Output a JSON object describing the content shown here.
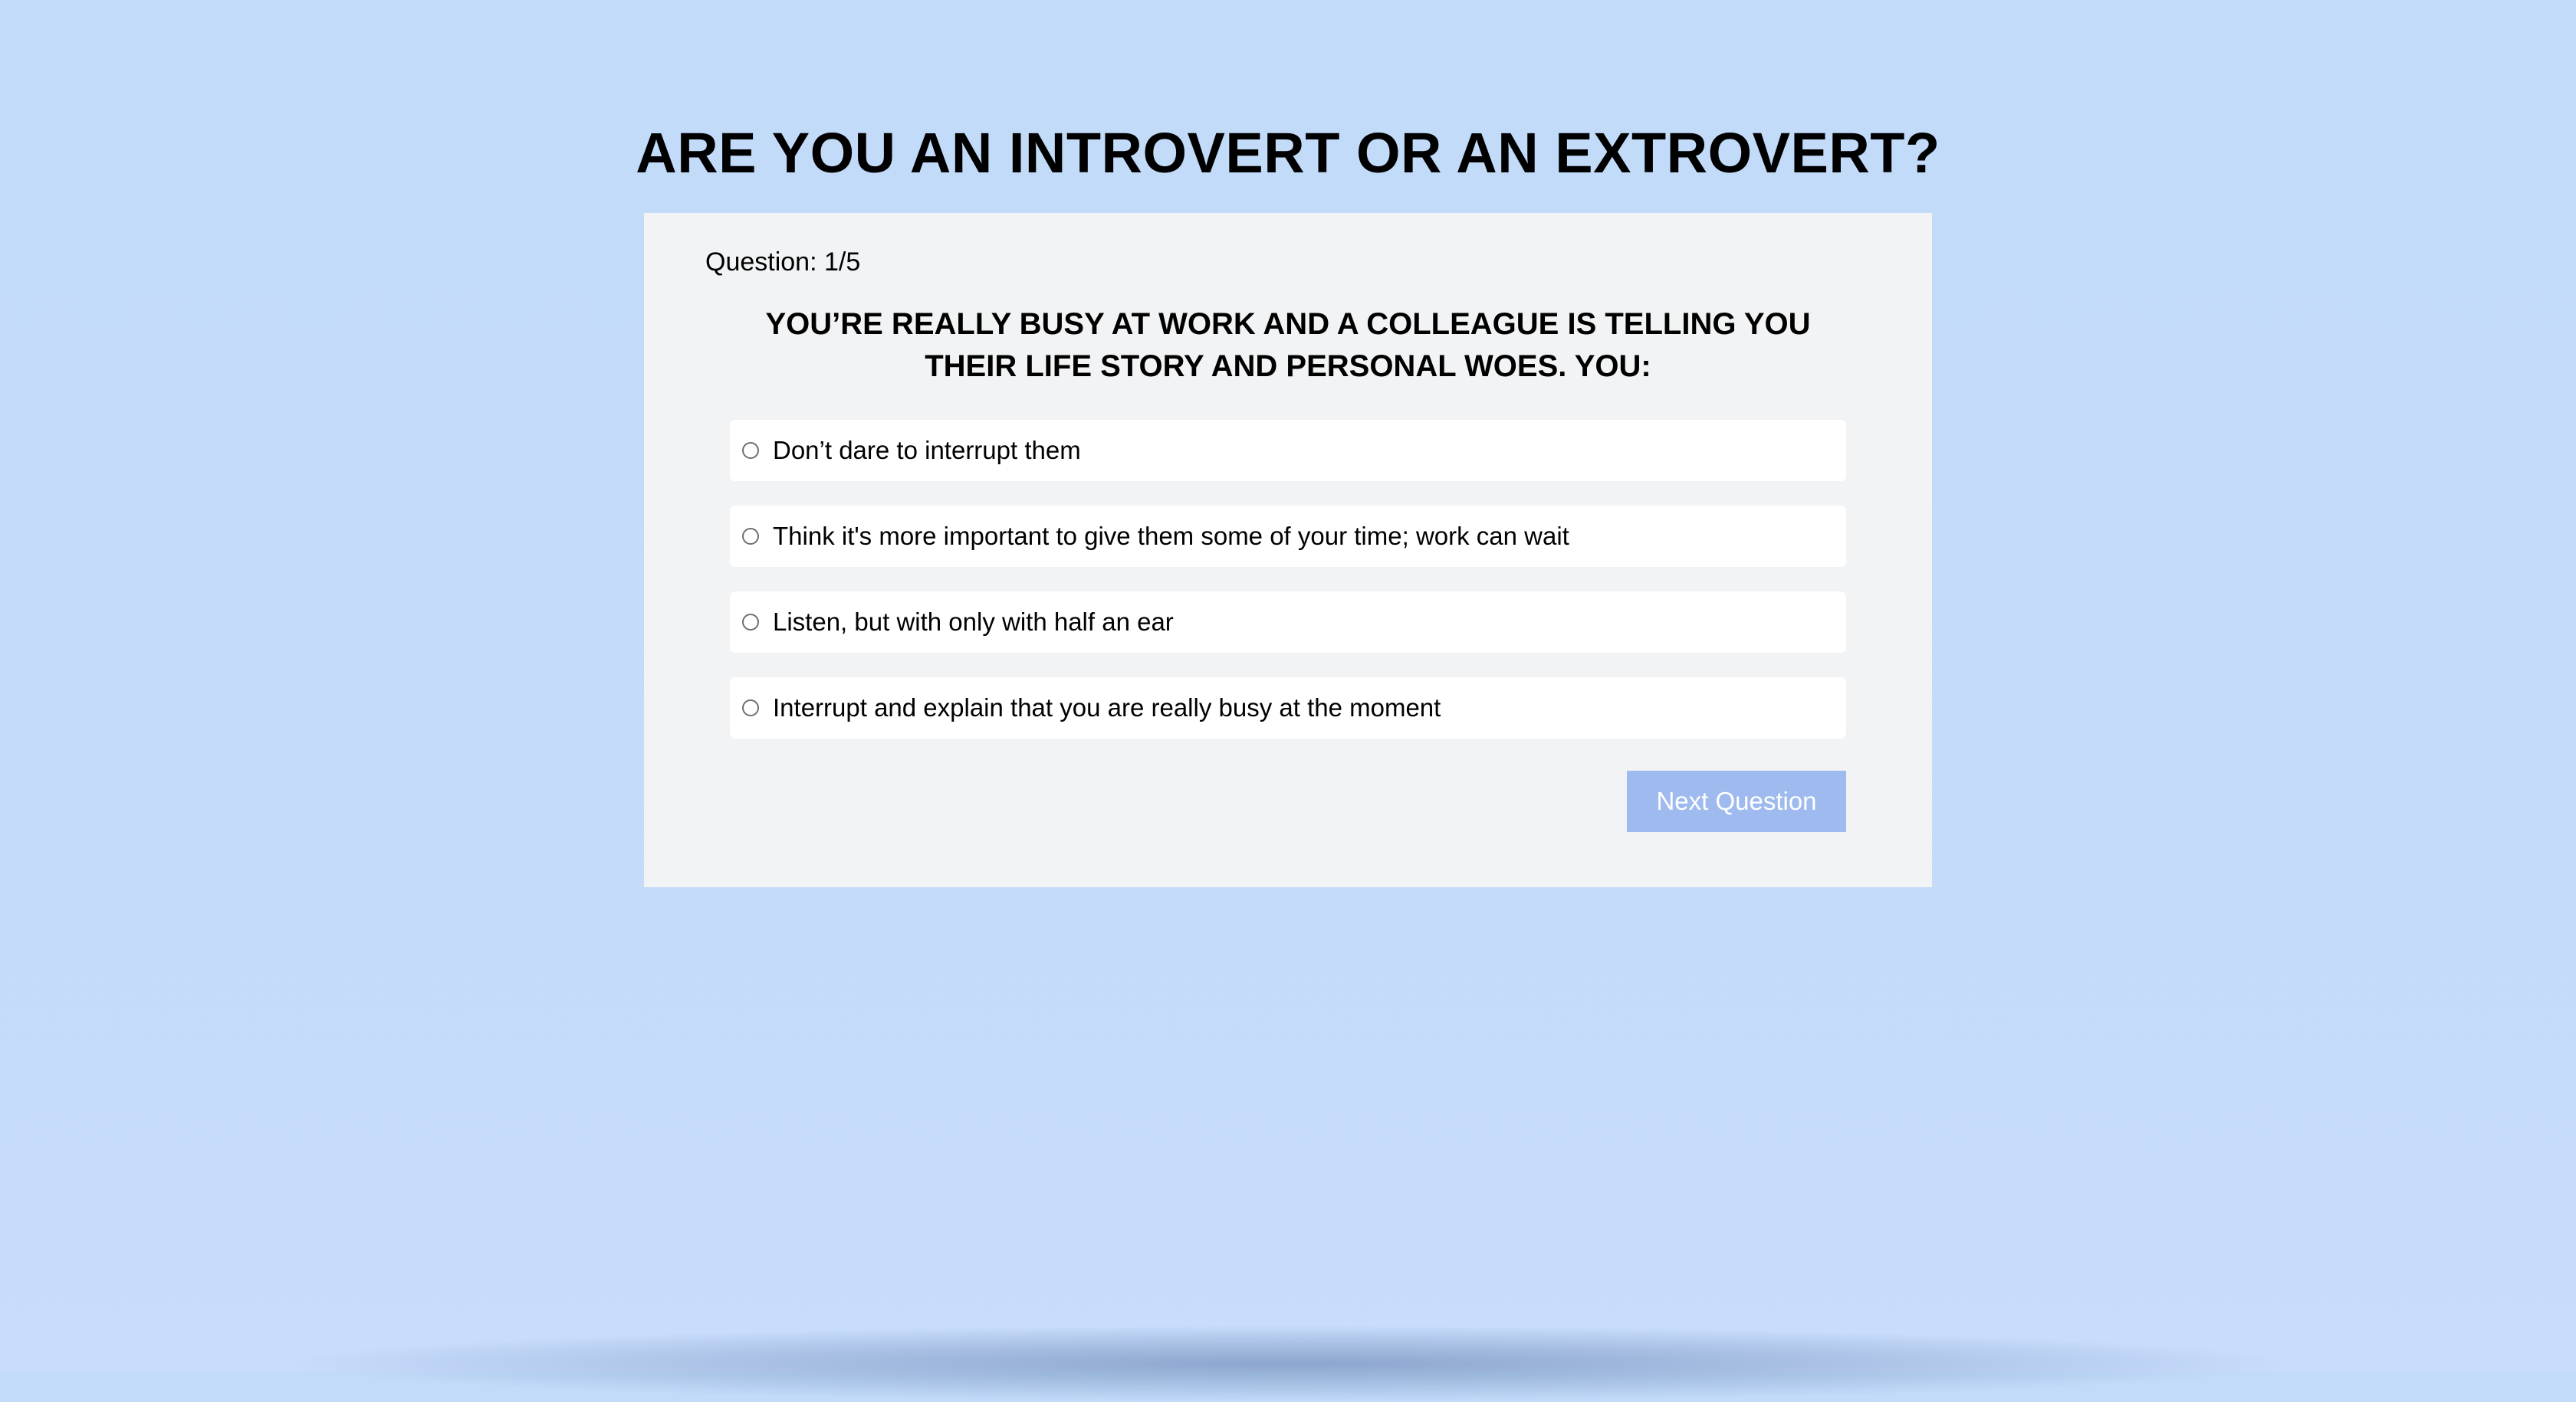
{
  "quiz": {
    "title": "ARE YOU AN INTROVERT OR AN EXTROVERT?",
    "counter": "Question: 1/5",
    "question": "YOU’RE REALLY BUSY AT WORK AND A COLLEAGUE IS TELLING YOU THEIR LIFE STORY AND PERSONAL WOES. YOU:",
    "options": [
      {
        "label": "Don’t dare to interrupt them",
        "selected": false
      },
      {
        "label": "Think it's more important to give them some of your time; work can wait",
        "selected": false
      },
      {
        "label": "Listen, but with only with half an ear",
        "selected": false
      },
      {
        "label": "Interrupt and explain that you are really busy at the moment",
        "selected": false
      }
    ],
    "next_button_label": "Next Question"
  },
  "colors": {
    "background": "#c2dbf9",
    "card": "#f2f3f5",
    "option": "#ffffff",
    "button_disabled": "#9fbaee",
    "button_text": "#ffffff"
  }
}
